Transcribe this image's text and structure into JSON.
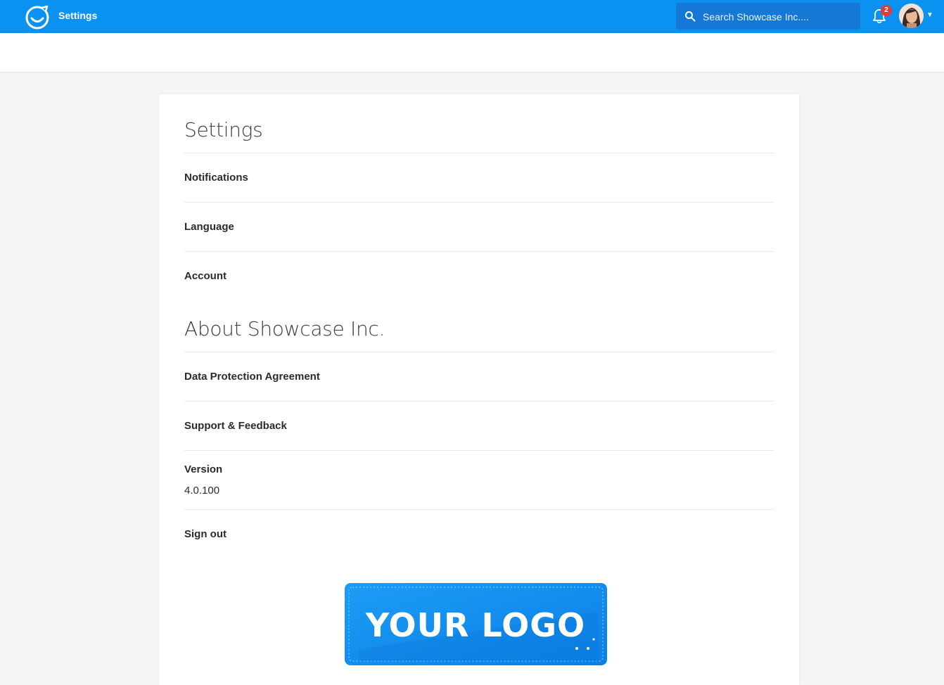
{
  "header": {
    "app_title": "Settings",
    "search_placeholder": "Search Showcase Inc....",
    "notification_count": "2",
    "brand_color": "#0b92f0"
  },
  "settings": {
    "heading": "Settings",
    "items": [
      {
        "label": "Notifications"
      },
      {
        "label": "Language"
      },
      {
        "label": "Account"
      }
    ]
  },
  "about": {
    "heading": "About Showcase Inc.",
    "items": [
      {
        "label": "Data Protection Agreement"
      },
      {
        "label": "Support & Feedback"
      }
    ],
    "version_label": "Version",
    "version_value": "4.0.100",
    "sign_out": "Sign out"
  },
  "logo": {
    "text": "YOUR LOGO"
  }
}
